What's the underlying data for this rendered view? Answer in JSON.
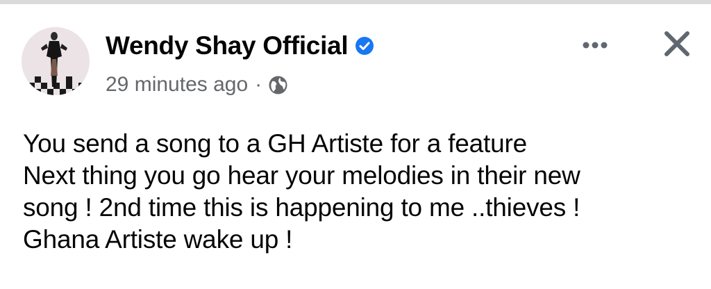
{
  "post": {
    "author": {
      "name": "Wendy Shay Official",
      "verified_icon": "verified-badge-icon",
      "avatar_icon": "profile-photo"
    },
    "meta": {
      "timestamp": "29 minutes ago",
      "separator": "·",
      "audience_icon": "globe-icon"
    },
    "actions": {
      "more_icon": "more-options-icon",
      "close_icon": "close-icon"
    },
    "message_lines": [
      "You send a song to a GH Artiste for a feature",
      "Next thing you go hear your melodies in their new",
      "song ! 2nd time this is happening to me ..thieves !",
      "Ghana Artiste wake up !"
    ]
  },
  "colors": {
    "text_primary": "#050505",
    "text_secondary": "#65676b",
    "verified_blue": "#1877f2",
    "divider": "#d9dadc"
  }
}
